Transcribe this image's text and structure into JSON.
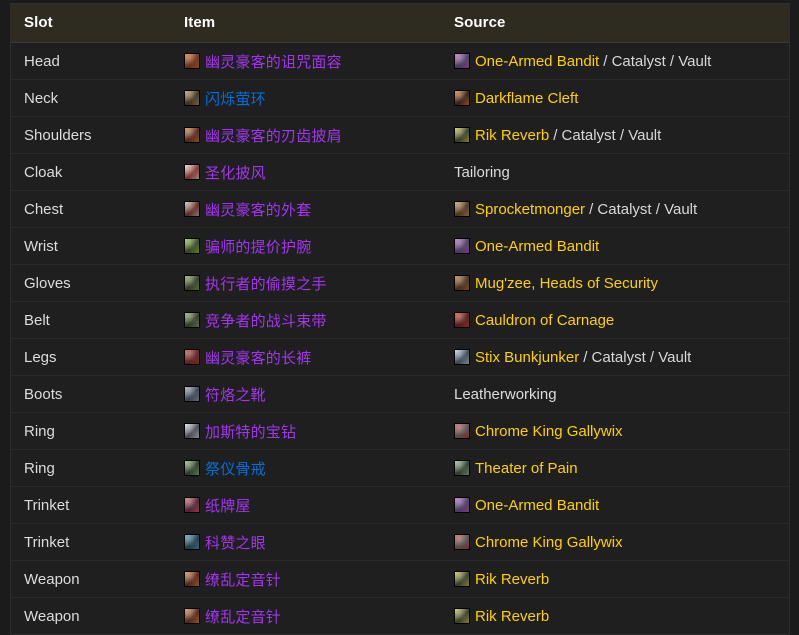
{
  "table": {
    "columns": [
      {
        "key": "slot",
        "label": "Slot"
      },
      {
        "key": "item",
        "label": "Item"
      },
      {
        "key": "source",
        "label": "Source"
      }
    ],
    "colors": {
      "quality_epic": "#a335ee",
      "quality_rare": "#0070dd",
      "source_name": "#ffd100",
      "source_suffix": "#d8d8d8",
      "header_background": "#2e2b20",
      "row_background": "#1f1f1f",
      "page_background": "#1b1b1b"
    },
    "rows": [
      {
        "slot": "Head",
        "item": {
          "name": "幽灵豪客的诅咒面容",
          "quality": "epic",
          "icon": "item-icon-head-mask",
          "icon_colors": [
            "#7a2a10",
            "#d4761f"
          ]
        },
        "source": {
          "name": "One-Armed Bandit",
          "suffix": " / Catalyst / Vault",
          "icon": "boss-icon-one-armed-bandit",
          "icon_colors": [
            "#4b3c6b",
            "#c85ad0"
          ]
        }
      },
      {
        "slot": "Neck",
        "item": {
          "name": "闪烁萤环",
          "quality": "rare",
          "icon": "item-icon-amulet",
          "icon_colors": [
            "#3a2b16",
            "#c29a52"
          ]
        },
        "source": {
          "name": "Darkflame Cleft",
          "suffix": "",
          "icon": "dungeon-icon-darkflame-cleft",
          "icon_colors": [
            "#2b1409",
            "#ef7a24"
          ]
        }
      },
      {
        "slot": "Shoulders",
        "item": {
          "name": "幽灵豪客的刃齿披肩",
          "quality": "epic",
          "icon": "item-icon-shoulders",
          "icon_colors": [
            "#5e1a12",
            "#d6892f"
          ]
        },
        "source": {
          "name": "Rik Reverb",
          "suffix": " / Catalyst / Vault",
          "icon": "boss-icon-rik-reverb",
          "icon_colors": [
            "#2f3d20",
            "#d8c83a"
          ]
        }
      },
      {
        "slot": "Cloak",
        "item": {
          "name": "圣化披风",
          "quality": "epic",
          "icon": "item-icon-cloak",
          "icon_colors": [
            "#9a2b2b",
            "#e8d9c2"
          ]
        },
        "source": {
          "name": "",
          "suffix": "",
          "plain": "Tailoring",
          "icon": null,
          "icon_colors": []
        }
      },
      {
        "slot": "Chest",
        "item": {
          "name": "幽灵豪客的外套",
          "quality": "epic",
          "icon": "item-icon-chest",
          "icon_colors": [
            "#6b2018",
            "#c9c2b4"
          ]
        },
        "source": {
          "name": "Sprocketmonger",
          "suffix": " / Catalyst / Vault",
          "icon": "boss-icon-sprocketmonger",
          "icon_colors": [
            "#4a3418",
            "#d99a3c"
          ]
        }
      },
      {
        "slot": "Wrist",
        "item": {
          "name": "骗师的提价护腕",
          "quality": "epic",
          "icon": "item-icon-bracers",
          "icon_colors": [
            "#2e4a14",
            "#8fd13a"
          ]
        },
        "source": {
          "name": "One-Armed Bandit",
          "suffix": "",
          "icon": "boss-icon-one-armed-bandit",
          "icon_colors": [
            "#4b3c6b",
            "#c85ad0"
          ]
        }
      },
      {
        "slot": "Gloves",
        "item": {
          "name": "执行者的偷摸之手",
          "quality": "epic",
          "icon": "item-icon-gloves",
          "icon_colors": [
            "#2c3f1c",
            "#8fa84c"
          ]
        },
        "source": {
          "name": "Mug'zee, Heads of Security",
          "suffix": "",
          "icon": "boss-icon-mugzee",
          "icon_colors": [
            "#4b2a14",
            "#c4722c"
          ]
        }
      },
      {
        "slot": "Belt",
        "item": {
          "name": "竞争者的战斗束带",
          "quality": "epic",
          "icon": "item-icon-belt",
          "icon_colors": [
            "#2a3a22",
            "#9aa868"
          ]
        },
        "source": {
          "name": "Cauldron of Carnage",
          "suffix": "",
          "icon": "boss-icon-cauldron-of-carnage",
          "icon_colors": [
            "#5c1410",
            "#dd3f24"
          ]
        }
      },
      {
        "slot": "Legs",
        "item": {
          "name": "幽灵豪客的长裤",
          "quality": "epic",
          "icon": "item-icon-legs",
          "icon_colors": [
            "#6a1a14",
            "#b8483a"
          ]
        },
        "source": {
          "name": "Stix Bunkjunker",
          "suffix": " / Catalyst / Vault",
          "icon": "boss-icon-stix-bunkjunker",
          "icon_colors": [
            "#394a5a",
            "#bcd7e8"
          ]
        }
      },
      {
        "slot": "Boots",
        "item": {
          "name": "符烙之靴",
          "quality": "epic",
          "icon": "item-icon-boots",
          "icon_colors": [
            "#3a4458",
            "#9aa8c4"
          ]
        },
        "source": {
          "name": "",
          "suffix": "",
          "plain": "Leatherworking",
          "icon": null,
          "icon_colors": []
        }
      },
      {
        "slot": "Ring",
        "item": {
          "name": "加斯特的宝钻",
          "quality": "epic",
          "icon": "item-icon-ring-gem",
          "icon_colors": [
            "#4a4a58",
            "#dfe4ee"
          ]
        },
        "source": {
          "name": "Chrome King Gallywix",
          "suffix": "",
          "icon": "boss-icon-chrome-king-gallywix",
          "icon_colors": [
            "#5a5a60",
            "#d8433a"
          ]
        }
      },
      {
        "slot": "Ring",
        "item": {
          "name": "祭仪骨戒",
          "quality": "rare",
          "icon": "item-icon-ring-bone",
          "icon_colors": [
            "#24381f",
            "#8fc27a"
          ]
        },
        "source": {
          "name": "Theater of Pain",
          "suffix": "",
          "icon": "dungeon-icon-theater-of-pain",
          "icon_colors": [
            "#2a3d2a",
            "#9cc19c"
          ]
        }
      },
      {
        "slot": "Trinket",
        "item": {
          "name": "纸牌屋",
          "quality": "epic",
          "icon": "item-icon-trinket-cards",
          "icon_colors": [
            "#5a1830",
            "#e05a78"
          ]
        },
        "source": {
          "name": "One-Armed Bandit",
          "suffix": "",
          "icon": "boss-icon-one-armed-bandit",
          "icon_colors": [
            "#4b3c6b",
            "#c85ad0"
          ]
        }
      },
      {
        "slot": "Trinket",
        "item": {
          "name": "科赞之眼",
          "quality": "epic",
          "icon": "item-icon-trinket-eye",
          "icon_colors": [
            "#1c3a4a",
            "#45a8c4"
          ]
        },
        "source": {
          "name": "Chrome King Gallywix",
          "suffix": "",
          "icon": "boss-icon-chrome-king-gallywix",
          "icon_colors": [
            "#5a5a60",
            "#d8433a"
          ]
        }
      },
      {
        "slot": "Weapon",
        "item": {
          "name": "缭乱定音针",
          "quality": "epic",
          "icon": "item-icon-weapon",
          "icon_colors": [
            "#5e1a10",
            "#e08a2a"
          ]
        },
        "source": {
          "name": "Rik Reverb",
          "suffix": "",
          "icon": "boss-icon-rik-reverb",
          "icon_colors": [
            "#2f3d20",
            "#d8c83a"
          ]
        }
      },
      {
        "slot": "Weapon",
        "item": {
          "name": "缭乱定音针",
          "quality": "epic",
          "icon": "item-icon-weapon",
          "icon_colors": [
            "#5e1a10",
            "#e08a2a"
          ]
        },
        "source": {
          "name": "Rik Reverb",
          "suffix": "",
          "icon": "boss-icon-rik-reverb",
          "icon_colors": [
            "#2f3d20",
            "#d8c83a"
          ]
        }
      }
    ]
  }
}
